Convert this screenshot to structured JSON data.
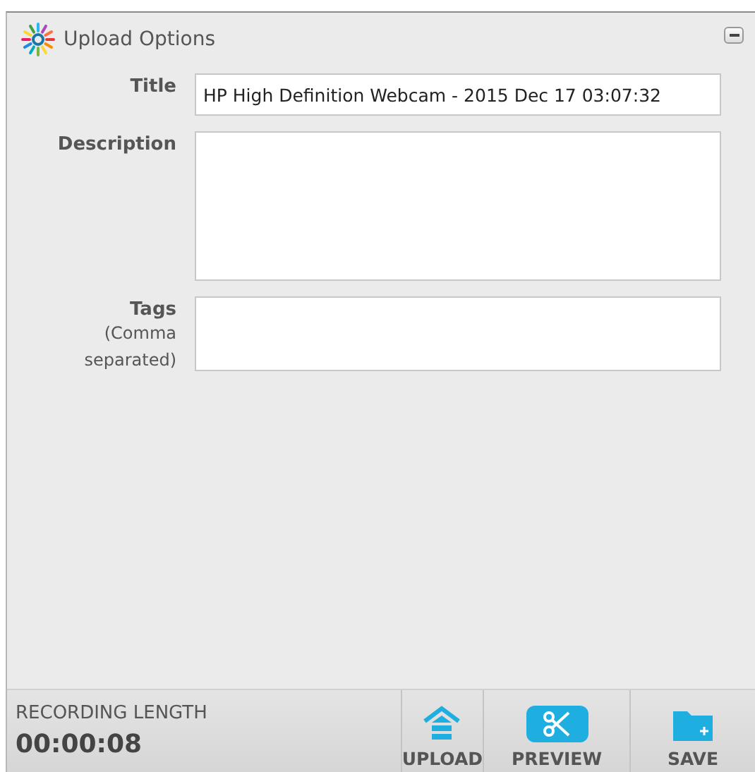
{
  "panel": {
    "title": "Upload Options"
  },
  "fields": [
    {
      "label": "Title",
      "kind": "line",
      "value": "HP High Definition Webcam - 2015 Dec 17 03:07:32"
    },
    {
      "label": "Description",
      "kind": "multiline"
    },
    {
      "label": "Tags",
      "note": "(Comma separated)",
      "kind": "line"
    }
  ],
  "status": {
    "label": "RECORDING LENGTH",
    "time": "00:00:08"
  },
  "buttons": [
    {
      "label": "UPLOAD"
    },
    {
      "label": "PREVIEW"
    },
    {
      "label": "SAVE"
    }
  ]
}
